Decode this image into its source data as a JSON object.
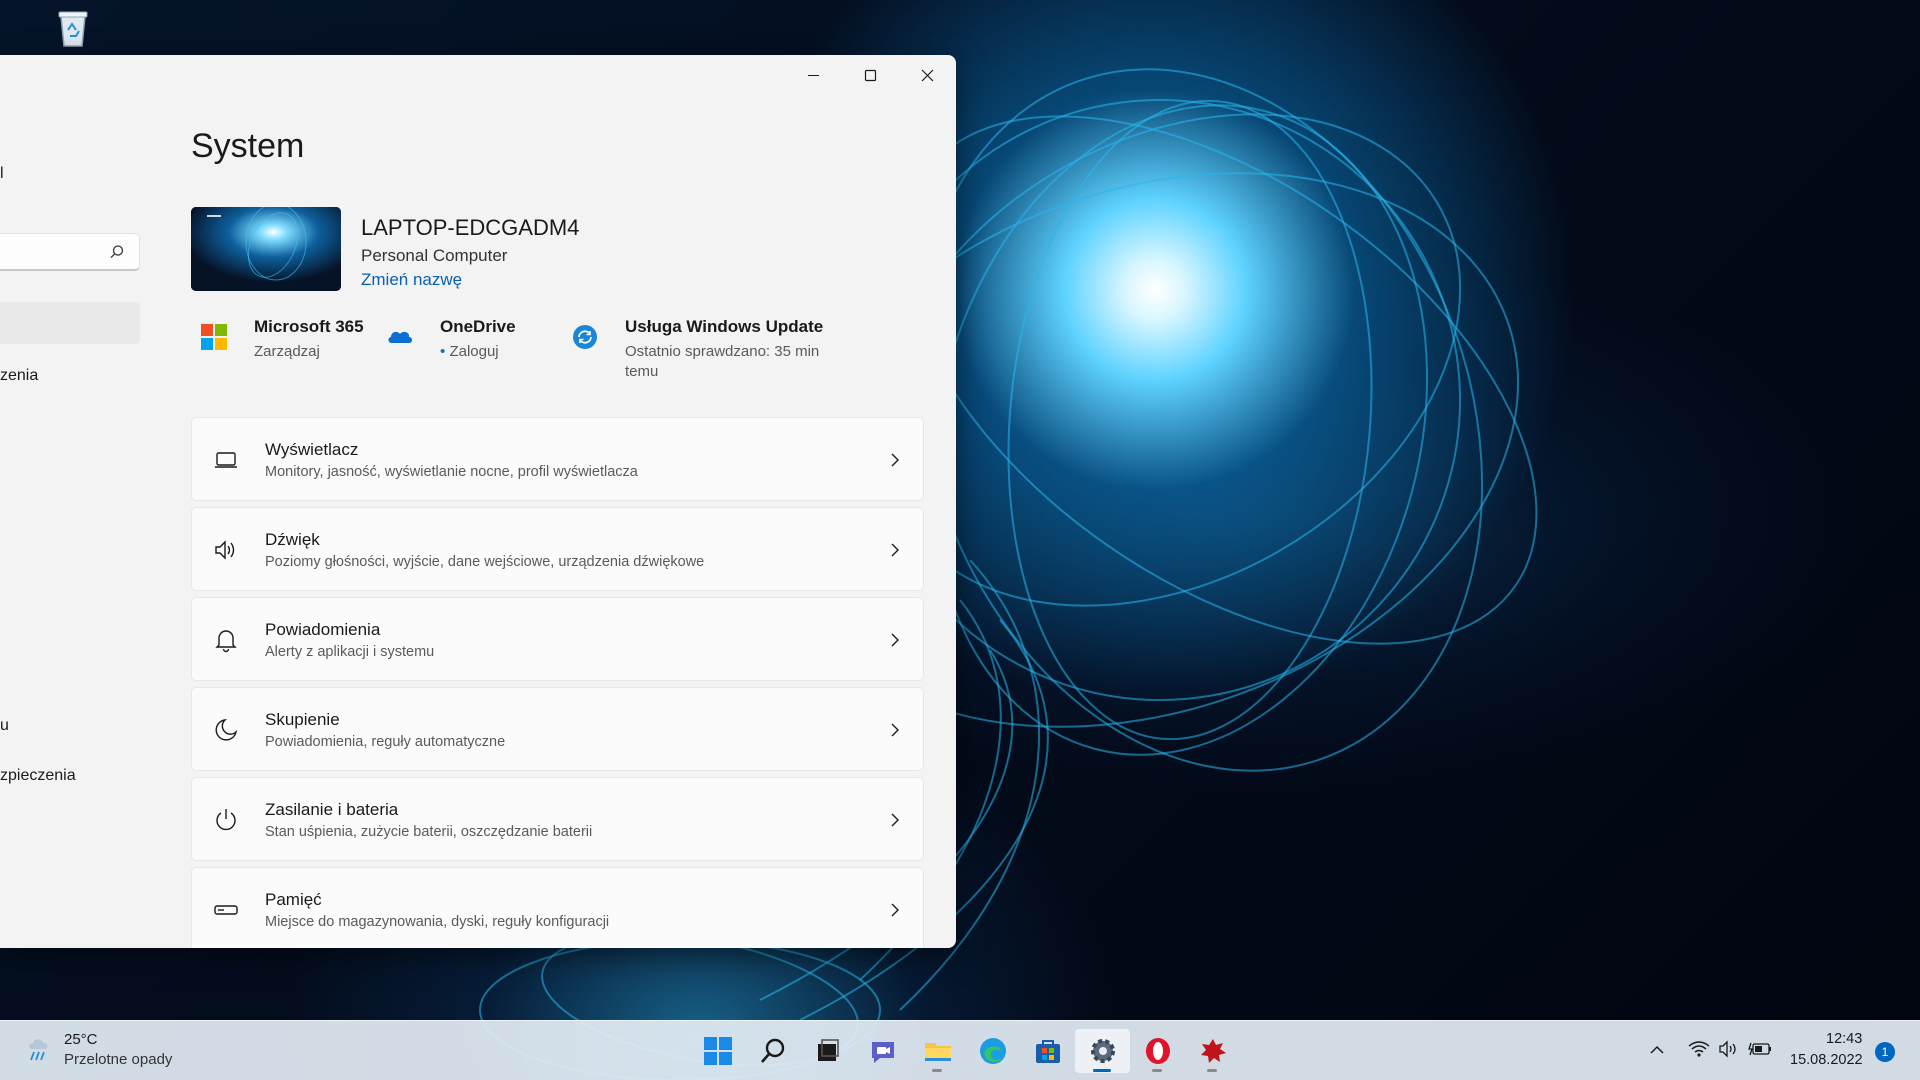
{
  "window": {
    "title": "System",
    "controls": {
      "minimize_icon": "minimize-icon",
      "maximize_icon": "maximize-icon",
      "close_icon": "close-icon"
    }
  },
  "nav_fragments": [
    {
      "id": "nav-frag-1",
      "label": "l"
    },
    {
      "id": "nav-frag-2",
      "label": "zenia"
    },
    {
      "id": "nav-frag-3",
      "label": "u"
    },
    {
      "id": "nav-frag-4",
      "label": "zpieczenia"
    }
  ],
  "device": {
    "name": "LAPTOP-EDCGADM4",
    "type": "Personal Computer",
    "rename": "Zmień nazwę"
  },
  "quick": [
    {
      "title": "Microsoft 365",
      "subtitle": "Zarządzaj",
      "icon": "microsoft-logo-icon"
    },
    {
      "title": "OneDrive",
      "subtitle": "Zaloguj",
      "icon": "onedrive-cloud-icon"
    },
    {
      "title": "Usługa Windows Update",
      "subtitle": "Ostatnio sprawdzano: 35 min temu",
      "icon": "windows-update-icon"
    }
  ],
  "settings": [
    {
      "title": "Wyświetlacz",
      "subtitle": "Monitory, jasność, wyświetlanie nocne, profil wyświetlacza",
      "icon": "display-icon"
    },
    {
      "title": "Dźwięk",
      "subtitle": "Poziomy głośności, wyjście, dane wejściowe, urządzenia dźwiękowe",
      "icon": "speaker-icon"
    },
    {
      "title": "Powiadomienia",
      "subtitle": "Alerty z aplikacji i systemu",
      "icon": "bell-icon"
    },
    {
      "title": "Skupienie",
      "subtitle": "Powiadomienia, reguły automatyczne",
      "icon": "moon-icon"
    },
    {
      "title": "Zasilanie i bateria",
      "subtitle": "Stan uśpienia, zużycie baterii, oszczędzanie baterii",
      "icon": "power-icon"
    },
    {
      "title": "Pamięć",
      "subtitle": "Miejsce do magazynowania, dyski, reguły konfiguracji",
      "icon": "storage-drive-icon"
    }
  ],
  "taskbar": {
    "weather": {
      "temperature": "25°C",
      "description": "Przelotne opady",
      "icon": "weather-rain-icon"
    },
    "apps": [
      "start-icon",
      "search-icon",
      "task-view-icon",
      "teams-chat-icon",
      "file-explorer-icon",
      "edge-icon",
      "store-icon",
      "settings-gear-icon",
      "opera-icon",
      "red-app-icon"
    ],
    "clock": {
      "time": "12:43",
      "date": "15.08.2022"
    },
    "notifications": "1"
  },
  "colors": {
    "accent": "#0067c0",
    "link": "#0a5fb4",
    "window_bg": "#f3f3f3",
    "card_bg": "#fbfbfb"
  }
}
